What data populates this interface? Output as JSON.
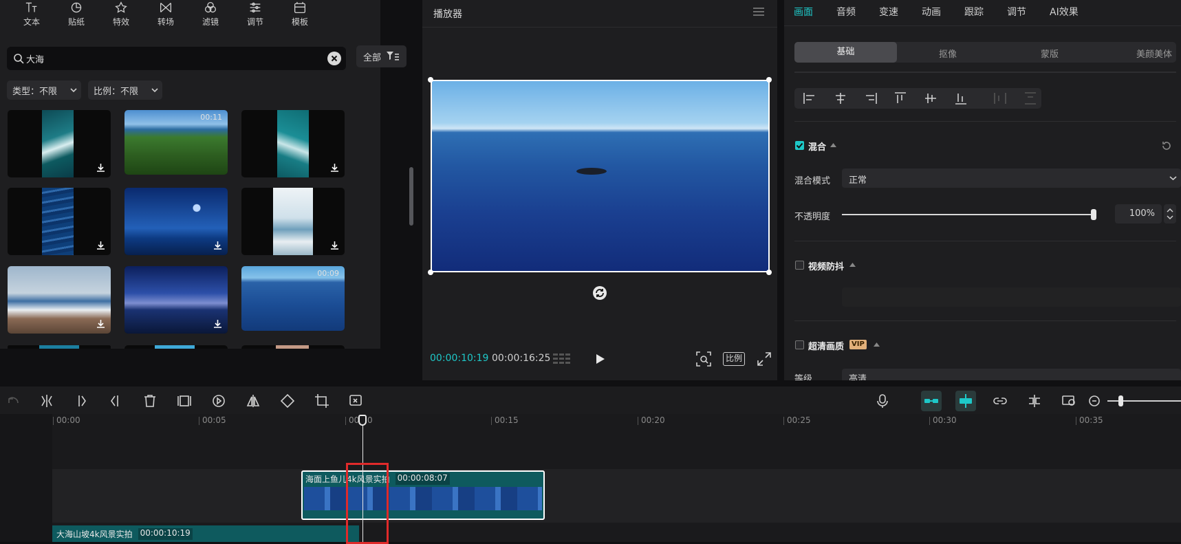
{
  "toolbar": {
    "items": [
      {
        "label": "文本",
        "icon": "text-icon"
      },
      {
        "label": "贴纸",
        "icon": "sticker-icon"
      },
      {
        "label": "特效",
        "icon": "effects-icon"
      },
      {
        "label": "转场",
        "icon": "transition-icon"
      },
      {
        "label": "滤镜",
        "icon": "filter-icon"
      },
      {
        "label": "调节",
        "icon": "adjust-icon"
      },
      {
        "label": "模板",
        "icon": "template-icon"
      }
    ]
  },
  "search": {
    "value": "大海",
    "all_label": "全部"
  },
  "filters": {
    "type_label": "类型：不限",
    "ratio_label": "比例：不限"
  },
  "media": {
    "durations": [
      "00:11",
      "00:09"
    ]
  },
  "player": {
    "title": "播放器",
    "current_time": "00:00:10:19",
    "total_time": "00:00:16:25",
    "ratio_label": "比例"
  },
  "props": {
    "tabs": [
      "画面",
      "音频",
      "变速",
      "动画",
      "跟踪",
      "调节",
      "AI效果"
    ],
    "subtabs": [
      "基础",
      "抠像",
      "蒙版",
      "美颜美体"
    ],
    "blend": {
      "label": "混合",
      "mode_label": "混合模式",
      "mode_value": "正常",
      "opacity_label": "不透明度",
      "opacity_value": "100%",
      "opacity_fraction": 1.0
    },
    "stabilize": {
      "label": "视频防抖"
    },
    "hd": {
      "label": "超清画质",
      "vip": "VIP",
      "level_label": "等级",
      "level_value": "高清"
    }
  },
  "timeline": {
    "ticks": [
      "00:00",
      "00:05",
      "00:10",
      "00:15",
      "00:20",
      "00:25",
      "00:30",
      "00:35"
    ],
    "clip1": {
      "name": "海面上鱼儿4k风景实拍",
      "duration": "00:00:08:07"
    },
    "clip2": {
      "name": "大海山坡4k风景实拍",
      "duration": "00:00:10:19"
    }
  },
  "colors": {
    "accent": "#1ec8c8",
    "clip": "#0e5a5e",
    "highlight": "#e02a2a"
  }
}
